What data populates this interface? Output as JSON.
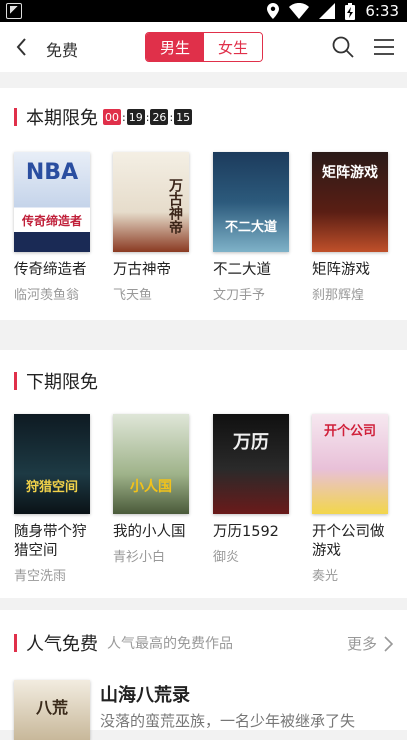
{
  "status_bar": {
    "time": "6:33"
  },
  "header": {
    "title": "免费",
    "tabs": [
      {
        "label": "男生",
        "active": true
      },
      {
        "label": "女生",
        "active": false
      }
    ]
  },
  "sections": {
    "current": {
      "title": "本期限免",
      "countdown": [
        "00",
        "19",
        "26",
        "15"
      ],
      "books": [
        {
          "title": "传奇缔造者",
          "author": "临河羡鱼翁",
          "cover_text": "传奇缔造者"
        },
        {
          "title": "万古神帝",
          "author": "飞天鱼",
          "cover_text": "万古神帝"
        },
        {
          "title": "不二大道",
          "author": "文刀手予",
          "cover_text": "不二大道"
        },
        {
          "title": "矩阵游戏",
          "author": "刹那辉煌",
          "cover_text": "矩阵游戏"
        }
      ]
    },
    "next": {
      "title": "下期限免",
      "books": [
        {
          "title": "随身带个狩猎空间",
          "author": "青空洗雨",
          "cover_text": "狩猎空间"
        },
        {
          "title": "我的小人国",
          "author": "青衫小白",
          "cover_text": "小人国"
        },
        {
          "title": "万历1592",
          "author": "御炎",
          "cover_text": "万历"
        },
        {
          "title": "开个公司做游戏",
          "author": "奏光",
          "cover_text": "开个公司"
        }
      ]
    },
    "popular": {
      "title": "人气免费",
      "subtitle": "人气最高的免费作品",
      "more_label": "更多",
      "book": {
        "title": "山海八荒录",
        "desc": "没落的蛮荒巫族，一名少年被继承了失",
        "cover_text": "八荒"
      }
    }
  },
  "colors": {
    "accent": "#e0304a"
  }
}
